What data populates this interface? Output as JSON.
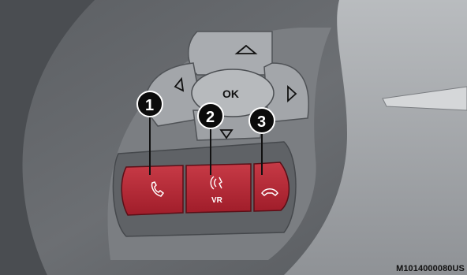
{
  "figure_code": "M1014000080US",
  "dpad": {
    "ok_label": "OK",
    "up_icon": "triangle-up-outline",
    "down_icon": "triangle-down-outline",
    "left_icon": "triangle-left-outline",
    "right_icon": "triangle-right-outline"
  },
  "buttons": {
    "phone": {
      "icon": "phone-handset-icon"
    },
    "voice": {
      "icon": "voice-recognition-icon",
      "label": "VR"
    },
    "hangup": {
      "icon": "hang-up-icon"
    }
  },
  "callouts": [
    {
      "number": "1"
    },
    {
      "number": "2"
    },
    {
      "number": "3"
    }
  ],
  "colors": {
    "button_red": "#b52532",
    "callout_fill": "#0b0b0b",
    "panel_grey": "#8c8f93",
    "dark_grey": "#55585c"
  }
}
